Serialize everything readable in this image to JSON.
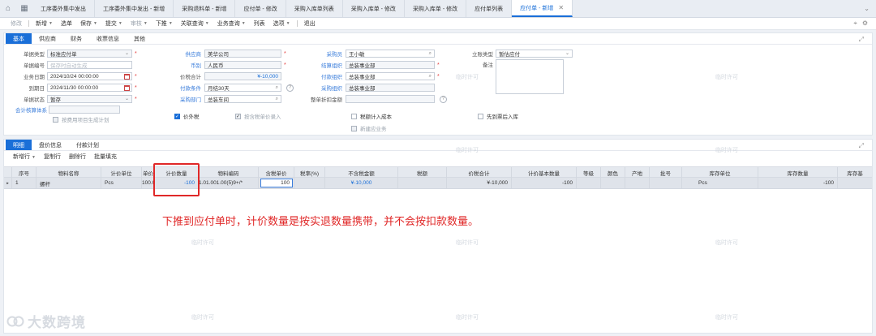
{
  "tabs": [
    {
      "label": "工序委外集中发出",
      "active": false
    },
    {
      "label": "工序委外集中发出 - 新增",
      "active": false
    },
    {
      "label": "采购退料单 - 新增",
      "active": false
    },
    {
      "label": "应付单 - 修改",
      "active": false
    },
    {
      "label": "采购入库单列表",
      "active": false
    },
    {
      "label": "采购入库单 - 修改",
      "active": false
    },
    {
      "label": "采购入库单 - 修改",
      "active": false
    },
    {
      "label": "应付单列表",
      "active": false
    },
    {
      "label": "应付单 - 新增",
      "active": true
    }
  ],
  "toolbar": [
    {
      "label": "修改",
      "dim": true,
      "caret": false
    },
    {
      "label": "新增",
      "dim": false,
      "caret": true
    },
    {
      "label": "选单",
      "dim": false,
      "caret": false
    },
    {
      "label": "保存",
      "dim": false,
      "caret": true
    },
    {
      "label": "提交",
      "dim": false,
      "caret": true
    },
    {
      "label": "审核",
      "dim": true,
      "caret": true
    },
    {
      "label": "下推",
      "dim": false,
      "caret": true
    },
    {
      "label": "关联查询",
      "dim": false,
      "caret": true
    },
    {
      "label": "业务查询",
      "dim": false,
      "caret": true
    },
    {
      "label": "列表",
      "dim": false,
      "caret": false
    },
    {
      "label": "选项",
      "dim": false,
      "caret": true
    },
    {
      "label": "退出",
      "dim": false,
      "caret": false
    }
  ],
  "header_tabs": [
    "基本",
    "供应商",
    "财务",
    "收票信息",
    "其他"
  ],
  "form": {
    "doc_type_label": "单据类型",
    "doc_type": "标准应付单",
    "doc_no_label": "单据编号",
    "doc_no_placeholder": "保存时自动生成",
    "biz_date_label": "业务日期",
    "biz_date": "2024/10/24 00:00:00",
    "due_date_label": "到期日",
    "due_date": "2024/11/30 00:00:00",
    "status_label": "单据状态",
    "status": "暂存",
    "acct_system_label": "会计核算体系",
    "supplier_label": "供应商",
    "supplier": "美华公司",
    "currency_label": "币别",
    "currency": "人民币",
    "total_tax_label": "价税合计",
    "total_tax": "¥-10,000",
    "pay_terms_label": "付款条件",
    "pay_terms": "月结30天",
    "purch_dept_label": "采购部门",
    "purch_dept": "总装车间",
    "buyer_label": "采购员",
    "buyer": "王小敏",
    "settle_org_label": "结算组织",
    "settle_org": "总装事业部",
    "pay_org_label": "付款组织",
    "pay_org": "总装事业部",
    "purch_org_label": "采购组织",
    "purch_org": "总装事业部",
    "discount_label": "整单折扣金额",
    "acct_type_label": "立账类型",
    "acct_type": "暂估应付",
    "remark_label": "备注"
  },
  "checkboxes": {
    "price_excl_tax": "价外税",
    "by_tax_price": "按含税单价录入",
    "tax_in_cost": "税额计入成本",
    "invoice_first": "先到票后入库",
    "new_shared": "新建应业务",
    "gen_plan": "按费用项目生成计划"
  },
  "detail_tabs": [
    "明细",
    "盘价信息",
    "付款计划"
  ],
  "detail_tools": [
    {
      "label": "新增行",
      "caret": true
    },
    {
      "label": "复制行",
      "caret": false
    },
    {
      "label": "删除行",
      "caret": false
    },
    {
      "label": "批量填充",
      "caret": false
    }
  ],
  "grid": {
    "headers": [
      "序号",
      "物料名称",
      "计价单位",
      "单价",
      "计价数量",
      "物料编码",
      "含税单价",
      "税率(%)",
      "不含税金额",
      "税额",
      "价税合计",
      "计价基本数量",
      "等级",
      "颜色",
      "产地",
      "批号",
      "库存单位",
      "库存数量",
      "库存基"
    ],
    "row": {
      "seq": "1",
      "material_name": "螺杆",
      "price_unit": "Pcs",
      "unit_price": "100.0",
      "price_qty": "-100",
      "material_code": "1.01.001.00(5)9+/*",
      "tax_price": "100",
      "tax_rate": "",
      "amount_excl_tax": "¥-10,000",
      "tax_amount": "",
      "total": "¥-10,000",
      "base_qty": "-100",
      "grade": "",
      "color": "",
      "origin": "",
      "batch": "",
      "stock_unit": "Pcs",
      "stock_qty": "-100"
    }
  },
  "annotation": "下推到应付单时，计价数量是按实退数量携带，并不会按扣款数量。",
  "watermark": "临时许可",
  "brand": "大数跨境",
  "colors": {
    "accent": "#1a6fd8",
    "highlight": "#e02828"
  }
}
